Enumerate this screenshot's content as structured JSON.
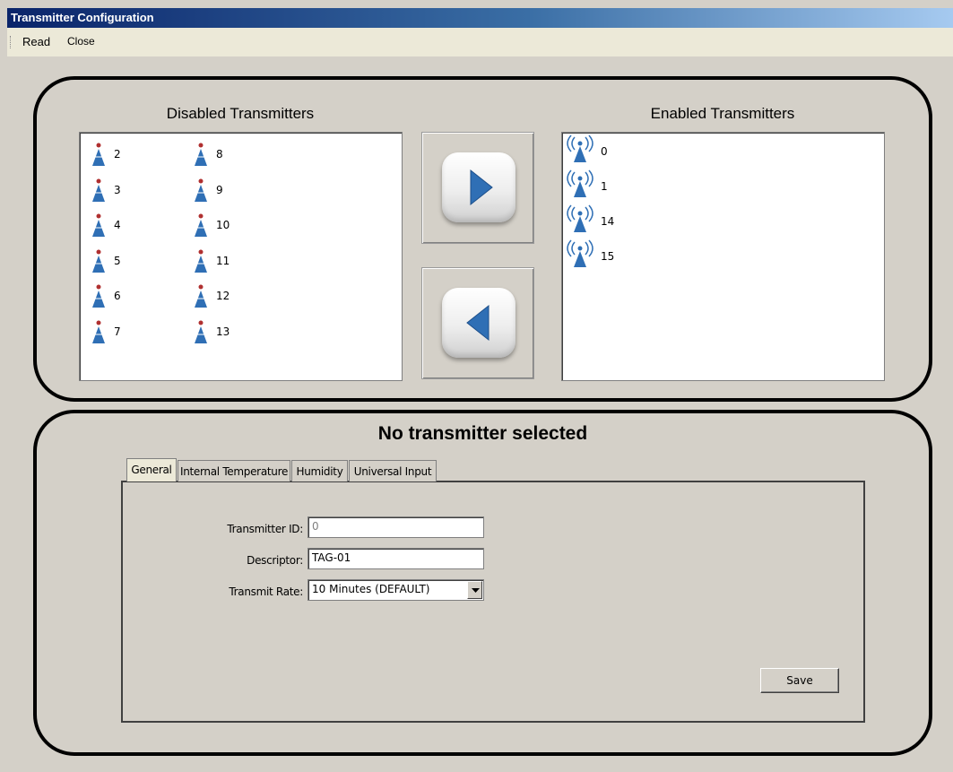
{
  "window": {
    "title": "Transmitter Configuration"
  },
  "menu": {
    "items": [
      "Read",
      "Close"
    ]
  },
  "disabled_panel": {
    "title": "Disabled Transmitters",
    "col1": [
      "2",
      "3",
      "4",
      "5",
      "6",
      "7"
    ],
    "col2": [
      "8",
      "9",
      "10",
      "11",
      "12",
      "13"
    ]
  },
  "enabled_panel": {
    "title": "Enabled Transmitters",
    "items": [
      "0",
      "1",
      "14",
      "15"
    ]
  },
  "details": {
    "headline": "No transmitter selected",
    "tabs": [
      "General",
      "Internal Temperature",
      "Humidity",
      "Universal Input"
    ],
    "active_tab": "General",
    "fields": {
      "transmitter_id_label": "Transmitter ID:",
      "transmitter_id_value": "0",
      "descriptor_label": "Descriptor:",
      "descriptor_value": "TAG-01",
      "transmit_rate_label": "Transmit Rate:",
      "transmit_rate_value": "10 Minutes (DEFAULT)"
    },
    "save_label": "Save"
  },
  "colors": {
    "accent_blue": "#2f6fb5",
    "title_bar": "#0a246a"
  }
}
